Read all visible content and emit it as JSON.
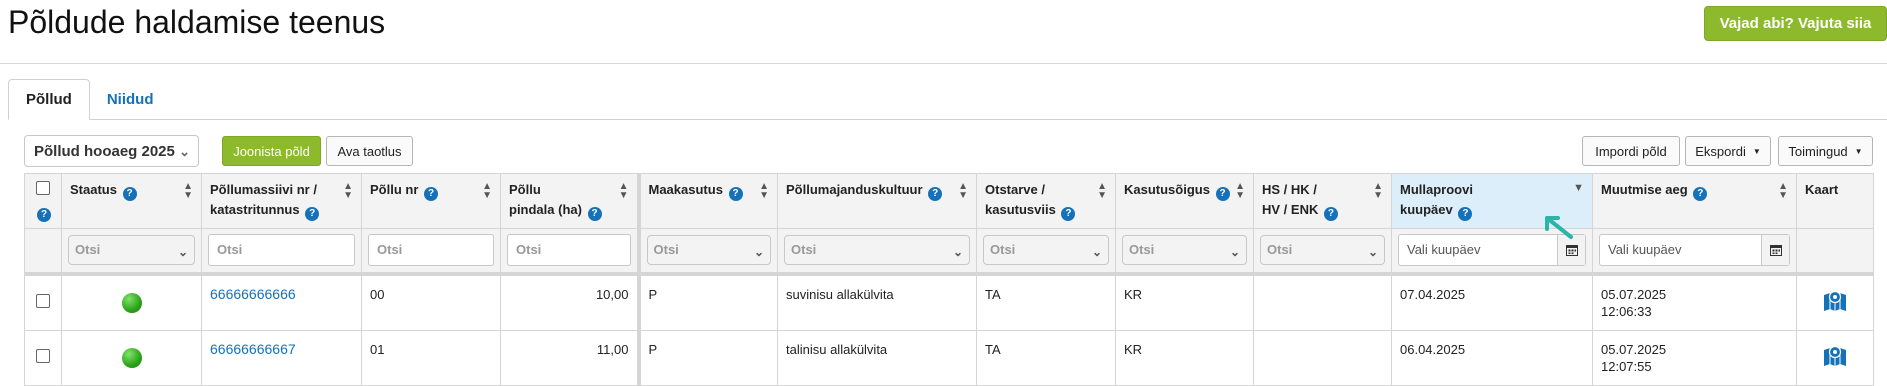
{
  "header": {
    "title": "Põldude haldamise teenus",
    "help_button": "Vajad abi? Vajuta siia"
  },
  "tabs": [
    {
      "label": "Põllud",
      "active": true
    },
    {
      "label": "Niidud",
      "active": false
    }
  ],
  "toolbar": {
    "season_select": "Põllud hooaeg 2025",
    "draw_button": "Joonista põld",
    "open_application_button": "Ava taotlus",
    "import_button": "Impordi põld",
    "export_button": "Ekspordi",
    "actions_button": "Toimingud"
  },
  "table": {
    "columns": {
      "status": "Staatus",
      "massiiv_1": "Põllumassiivi nr /",
      "massiiv_2": "katastritunnus",
      "pollu_nr": "Põllu nr",
      "pindala_1": "Põllu",
      "pindala_2": "pindala (ha)",
      "maakasutus": "Maakasutus",
      "kultuur": "Põllumajanduskultuur",
      "otstarve_1": "Otstarve /",
      "otstarve_2": "kasutusviis",
      "kasutusoigus": "Kasutusõigus",
      "hs_1": "HS / HK /",
      "hs_2": "HV / ENK",
      "mullaproov_1": "Mullaproovi",
      "mullaproov_2": "kuupäev",
      "muutmise_aeg": "Muutmise aeg",
      "kaart": "Kaart"
    },
    "filters": {
      "search_placeholder": "Otsi",
      "date_placeholder": "Vali kuupäev"
    },
    "rows": [
      {
        "massiiv": "66666666666",
        "pollu_nr": "00",
        "pindala": "10,00",
        "maakasutus": "P",
        "kultuur": "suvinisu allakülvita",
        "otstarve": "TA",
        "kasutusoigus": "KR",
        "hs": "",
        "mullaproov": "07.04.2025",
        "muutmise_kuupaev": "05.07.2025",
        "muutmise_kell": "12:06:33"
      },
      {
        "massiiv": "66666666667",
        "pollu_nr": "01",
        "pindala": "11,00",
        "maakasutus": "P",
        "kultuur": "talinisu allakülvita",
        "otstarve": "TA",
        "kasutusoigus": "KR",
        "hs": "",
        "mullaproov": "06.04.2025",
        "muutmise_kuupaev": "05.07.2025",
        "muutmise_kell": "12:07:55"
      }
    ]
  },
  "colors": {
    "accent_green": "#8dba2d",
    "link_blue": "#1572b8",
    "sorted_header": "#dbeefa",
    "arrow": "#2bb5a8"
  }
}
